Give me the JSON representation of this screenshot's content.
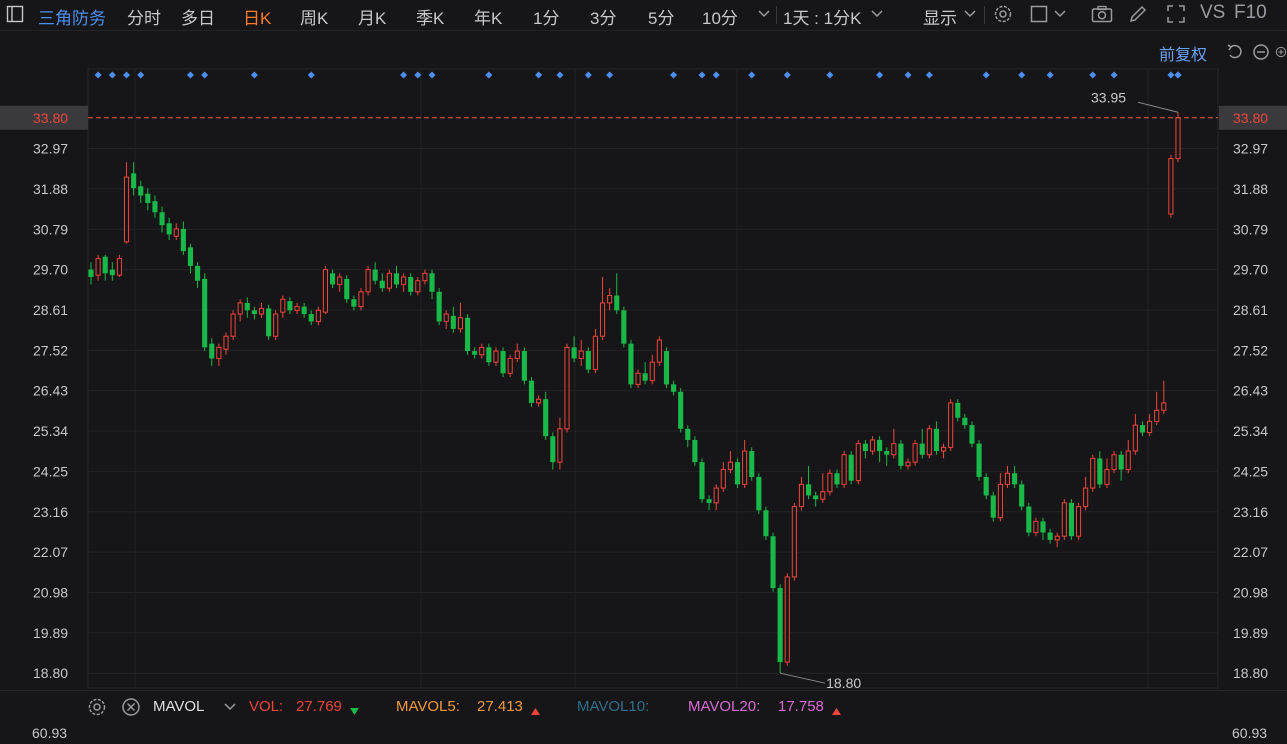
{
  "toolbar": {
    "stock_name": "三角防务",
    "periods": [
      "分时",
      "多日",
      "日K",
      "周K",
      "月K",
      "季K",
      "年K",
      "1分",
      "3分",
      "5分",
      "10分"
    ],
    "active_period": "日K",
    "range_label": "1天 : 1分K",
    "display_label": "显示",
    "vs_label": "VS",
    "f10_label": "F10"
  },
  "adjust_label": "前复权",
  "price_axis": {
    "ticks": [
      "32.97",
      "31.88",
      "30.79",
      "29.70",
      "28.61",
      "27.52",
      "26.43",
      "25.34",
      "24.25",
      "23.16",
      "22.07",
      "20.98",
      "19.89",
      "18.80"
    ],
    "current_price": "33.80",
    "high_label": "33.95",
    "low_label": "18.80"
  },
  "indicator": {
    "name": "MAVOL",
    "vol_label": "VOL:",
    "vol_value": "27.769",
    "ma5_label": "MAVOL5:",
    "ma5_value": "27.413",
    "ma10_label": "MAVOL10:",
    "ma20_label": "MAVOL20:",
    "ma20_value": "17.758",
    "axis_top": "60.93"
  },
  "colors": {
    "up": "#f0453a",
    "down": "#18b948",
    "marker": "#4d8ff0",
    "price_line": "#e55b3c",
    "ma5": "#f2993b",
    "ma10": "#2e6e8c",
    "ma20": "#d76ad6"
  },
  "chart_data": {
    "type": "candlestick",
    "ylim": [
      18.4,
      34.2
    ],
    "high": 33.95,
    "low": 18.8,
    "last": 33.8,
    "candles": [
      [
        29.7,
        29.5,
        29.9,
        29.3
      ],
      [
        29.55,
        30.0,
        30.1,
        29.4
      ],
      [
        30.05,
        29.6,
        30.1,
        29.4
      ],
      [
        29.7,
        29.55,
        29.9,
        29.4
      ],
      [
        29.55,
        30.0,
        30.1,
        29.5
      ],
      [
        30.45,
        32.2,
        32.6,
        30.4
      ],
      [
        32.3,
        31.9,
        32.6,
        31.7
      ],
      [
        31.95,
        31.7,
        32.1,
        31.5
      ],
      [
        31.75,
        31.5,
        31.9,
        31.3
      ],
      [
        31.55,
        31.25,
        31.7,
        31.1
      ],
      [
        31.25,
        30.9,
        31.4,
        30.7
      ],
      [
        30.95,
        30.65,
        31.1,
        30.5
      ],
      [
        30.6,
        30.8,
        30.95,
        30.5
      ],
      [
        30.8,
        30.2,
        31.0,
        30.1
      ],
      [
        30.3,
        29.8,
        30.4,
        29.6
      ],
      [
        29.8,
        29.4,
        29.9,
        29.2
      ],
      [
        29.45,
        27.6,
        29.6,
        27.5
      ],
      [
        27.7,
        27.3,
        27.85,
        27.1
      ],
      [
        27.3,
        27.6,
        27.7,
        27.1
      ],
      [
        27.55,
        27.9,
        28.0,
        27.4
      ],
      [
        27.9,
        28.5,
        28.6,
        27.8
      ],
      [
        28.5,
        28.8,
        28.9,
        28.3
      ],
      [
        28.8,
        28.6,
        28.95,
        28.4
      ],
      [
        28.6,
        28.5,
        28.7,
        28.35
      ],
      [
        28.5,
        28.65,
        28.8,
        28.4
      ],
      [
        28.65,
        27.9,
        28.75,
        27.8
      ],
      [
        27.9,
        28.5,
        28.6,
        27.8
      ],
      [
        28.55,
        28.9,
        29.0,
        28.4
      ],
      [
        28.85,
        28.6,
        28.95,
        28.5
      ],
      [
        28.6,
        28.7,
        28.8,
        28.5
      ],
      [
        28.7,
        28.5,
        28.8,
        28.4
      ],
      [
        28.5,
        28.3,
        28.6,
        28.2
      ],
      [
        28.3,
        28.6,
        28.7,
        28.2
      ],
      [
        28.55,
        29.7,
        29.8,
        28.5
      ],
      [
        29.6,
        29.3,
        29.7,
        29.2
      ],
      [
        29.3,
        29.5,
        29.6,
        29.1
      ],
      [
        29.45,
        28.9,
        29.55,
        28.8
      ],
      [
        28.9,
        28.7,
        29.0,
        28.6
      ],
      [
        28.7,
        29.1,
        29.2,
        28.6
      ],
      [
        29.1,
        29.7,
        29.8,
        29.0
      ],
      [
        29.7,
        29.4,
        29.9,
        29.3
      ],
      [
        29.4,
        29.2,
        29.6,
        29.1
      ],
      [
        29.2,
        29.6,
        29.7,
        29.1
      ],
      [
        29.6,
        29.3,
        29.8,
        29.2
      ],
      [
        29.3,
        29.5,
        29.6,
        29.1
      ],
      [
        29.5,
        29.1,
        29.6,
        29.0
      ],
      [
        29.1,
        29.4,
        29.5,
        29.0
      ],
      [
        29.4,
        29.6,
        29.7,
        29.3
      ],
      [
        29.6,
        29.1,
        29.7,
        28.9
      ],
      [
        29.1,
        28.3,
        29.2,
        28.2
      ],
      [
        28.3,
        28.5,
        28.6,
        28.1
      ],
      [
        28.45,
        28.1,
        28.7,
        28.0
      ],
      [
        28.1,
        28.4,
        28.8,
        28.0
      ],
      [
        28.4,
        27.5,
        28.5,
        27.4
      ],
      [
        27.5,
        27.4,
        27.6,
        27.3
      ],
      [
        27.4,
        27.6,
        27.7,
        27.3
      ],
      [
        27.6,
        27.2,
        27.7,
        27.1
      ],
      [
        27.2,
        27.5,
        27.6,
        27.1
      ],
      [
        27.5,
        26.9,
        27.6,
        26.8
      ],
      [
        26.9,
        27.3,
        27.4,
        26.8
      ],
      [
        27.3,
        27.5,
        27.7,
        27.2
      ],
      [
        27.5,
        26.7,
        27.6,
        26.6
      ],
      [
        26.7,
        26.1,
        26.8,
        26.0
      ],
      [
        26.1,
        26.2,
        26.3,
        26.0
      ],
      [
        26.2,
        25.2,
        26.4,
        25.1
      ],
      [
        25.2,
        24.5,
        25.3,
        24.3
      ],
      [
        24.5,
        25.4,
        25.7,
        24.3
      ],
      [
        25.4,
        27.6,
        27.7,
        25.3
      ],
      [
        27.6,
        27.3,
        27.9,
        27.2
      ],
      [
        27.3,
        27.5,
        27.8,
        27.1
      ],
      [
        27.5,
        27.0,
        27.6,
        26.9
      ],
      [
        27.0,
        27.9,
        28.1,
        26.9
      ],
      [
        27.9,
        28.8,
        29.5,
        27.8
      ],
      [
        28.8,
        29.0,
        29.2,
        28.6
      ],
      [
        29.0,
        28.6,
        29.6,
        28.5
      ],
      [
        28.6,
        27.7,
        28.7,
        27.6
      ],
      [
        27.7,
        26.6,
        27.8,
        26.5
      ],
      [
        26.6,
        26.9,
        27.0,
        26.5
      ],
      [
        26.9,
        26.7,
        27.2,
        26.6
      ],
      [
        26.7,
        27.2,
        27.4,
        26.6
      ],
      [
        27.2,
        27.8,
        27.9,
        27.1
      ],
      [
        27.5,
        26.6,
        27.6,
        26.5
      ],
      [
        26.6,
        26.4,
        26.7,
        26.3
      ],
      [
        26.4,
        25.4,
        26.5,
        25.3
      ],
      [
        25.4,
        25.1,
        25.5,
        24.9
      ],
      [
        25.1,
        24.5,
        25.2,
        24.4
      ],
      [
        24.5,
        23.5,
        24.6,
        23.4
      ],
      [
        23.5,
        23.4,
        23.6,
        23.2
      ],
      [
        23.4,
        23.8,
        23.9,
        23.2
      ],
      [
        23.8,
        24.3,
        24.5,
        23.7
      ],
      [
        24.3,
        24.5,
        24.8,
        24.2
      ],
      [
        24.5,
        23.9,
        24.6,
        23.8
      ],
      [
        23.9,
        24.8,
        25.1,
        23.8
      ],
      [
        24.8,
        24.1,
        24.9,
        24.0
      ],
      [
        24.1,
        23.2,
        24.2,
        23.1
      ],
      [
        23.2,
        22.5,
        23.3,
        22.4
      ],
      [
        22.5,
        21.1,
        22.6,
        21.0
      ],
      [
        21.1,
        19.1,
        21.2,
        18.8
      ],
      [
        19.1,
        21.4,
        21.5,
        19.0
      ],
      [
        21.4,
        23.3,
        23.4,
        21.3
      ],
      [
        23.3,
        23.9,
        24.1,
        23.2
      ],
      [
        23.9,
        23.6,
        24.4,
        23.5
      ],
      [
        23.6,
        23.5,
        23.7,
        23.3
      ],
      [
        23.5,
        23.7,
        24.2,
        23.4
      ],
      [
        23.7,
        24.2,
        24.3,
        23.6
      ],
      [
        24.2,
        23.9,
        24.3,
        23.8
      ],
      [
        23.9,
        24.7,
        24.8,
        23.8
      ],
      [
        24.7,
        24.0,
        24.8,
        23.9
      ],
      [
        24.0,
        25.0,
        25.1,
        23.9
      ],
      [
        25.0,
        24.8,
        25.1,
        24.6
      ],
      [
        24.8,
        25.1,
        25.2,
        24.7
      ],
      [
        25.1,
        24.8,
        25.2,
        24.5
      ],
      [
        24.8,
        24.7,
        24.9,
        24.4
      ],
      [
        24.7,
        25.0,
        25.4,
        24.6
      ],
      [
        25.0,
        24.4,
        25.1,
        24.3
      ],
      [
        24.4,
        24.5,
        24.6,
        24.3
      ],
      [
        24.5,
        25.0,
        25.1,
        24.4
      ],
      [
        25.0,
        24.7,
        25.4,
        24.6
      ],
      [
        24.7,
        25.4,
        25.5,
        24.6
      ],
      [
        25.4,
        24.8,
        25.6,
        24.7
      ],
      [
        24.8,
        24.9,
        25.0,
        24.6
      ],
      [
        24.9,
        26.1,
        26.2,
        24.8
      ],
      [
        26.1,
        25.7,
        26.2,
        25.6
      ],
      [
        25.7,
        25.5,
        25.8,
        25.4
      ],
      [
        25.5,
        25.0,
        25.6,
        24.9
      ],
      [
        25.0,
        24.1,
        25.1,
        24.0
      ],
      [
        24.1,
        23.6,
        24.2,
        23.5
      ],
      [
        23.6,
        23.0,
        23.7,
        22.9
      ],
      [
        23.0,
        23.9,
        24.2,
        22.9
      ],
      [
        23.9,
        24.2,
        24.4,
        23.8
      ],
      [
        24.2,
        23.9,
        24.4,
        23.8
      ],
      [
        23.9,
        23.3,
        24.0,
        23.2
      ],
      [
        23.3,
        22.6,
        23.4,
        22.5
      ],
      [
        22.6,
        22.9,
        23.0,
        22.5
      ],
      [
        22.9,
        22.6,
        23.0,
        22.4
      ],
      [
        22.6,
        22.4,
        22.7,
        22.3
      ],
      [
        22.4,
        22.5,
        22.6,
        22.2
      ],
      [
        22.5,
        23.4,
        23.5,
        22.4
      ],
      [
        23.4,
        22.5,
        23.5,
        22.4
      ],
      [
        22.5,
        23.3,
        23.4,
        22.4
      ],
      [
        23.3,
        23.8,
        24.1,
        23.2
      ],
      [
        23.8,
        24.6,
        24.7,
        23.7
      ],
      [
        24.6,
        23.9,
        24.8,
        23.8
      ],
      [
        23.9,
        24.3,
        24.6,
        23.8
      ],
      [
        24.3,
        24.7,
        24.8,
        24.2
      ],
      [
        24.7,
        24.3,
        24.8,
        24.0
      ],
      [
        24.3,
        24.8,
        25.1,
        24.2
      ],
      [
        24.8,
        25.5,
        25.8,
        24.7
      ],
      [
        25.5,
        25.3,
        25.6,
        25.2
      ],
      [
        25.3,
        25.6,
        25.8,
        25.2
      ],
      [
        25.6,
        25.9,
        26.4,
        25.5
      ],
      [
        25.9,
        26.1,
        26.7,
        25.8
      ],
      [
        31.2,
        32.7,
        32.8,
        31.1
      ],
      [
        32.7,
        33.8,
        33.95,
        32.6
      ]
    ]
  }
}
